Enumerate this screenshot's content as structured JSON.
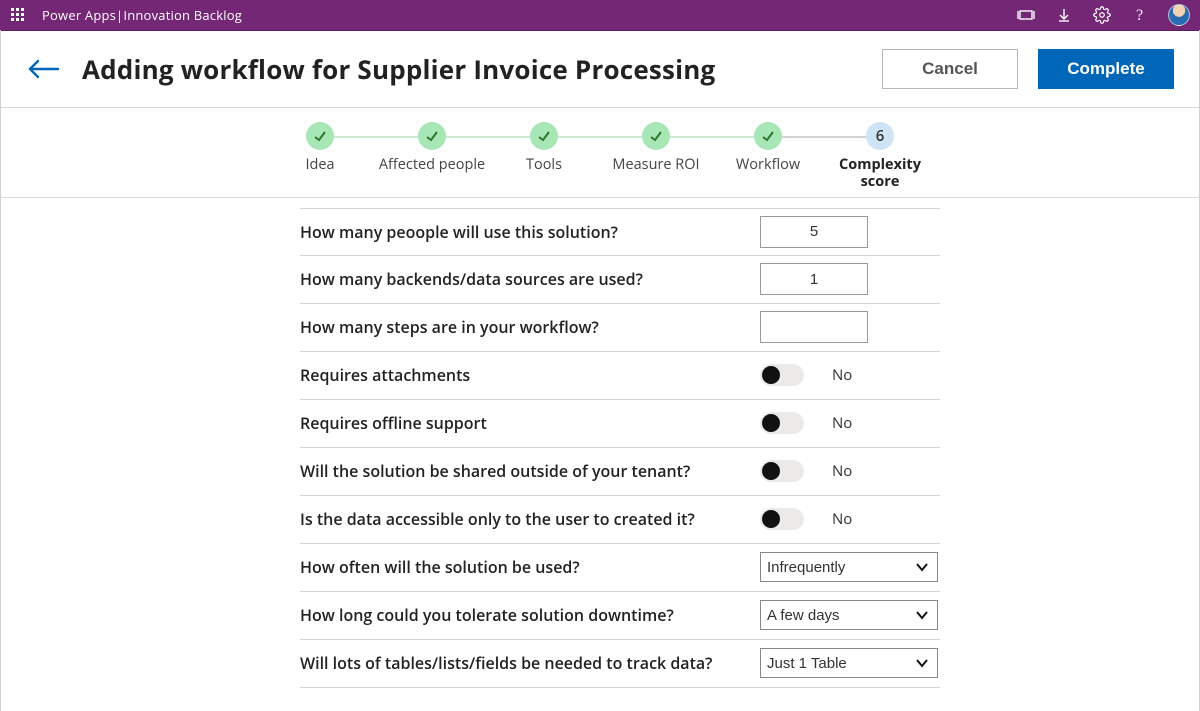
{
  "topbar": {
    "product": "Power Apps",
    "separator": "  |  ",
    "appname": "Innovation Backlog"
  },
  "header": {
    "title": "Adding workflow for Supplier Invoice Processing",
    "cancel": "Cancel",
    "complete": "Complete"
  },
  "stepper": {
    "steps": [
      {
        "label": "Idea",
        "done": true
      },
      {
        "label": "Affected people",
        "done": true
      },
      {
        "label": "Tools",
        "done": true
      },
      {
        "label": "Measure ROI",
        "done": true
      },
      {
        "label": "Workflow",
        "done": true
      },
      {
        "label": "Complexity score",
        "done": false,
        "current": true,
        "num": "6"
      }
    ]
  },
  "form": {
    "q_people": "How many peoople will use this solution?",
    "v_people": "5",
    "q_backends": "How many backends/data sources are  used?",
    "v_backends": "1",
    "q_steps": "How many steps are in your workflow?",
    "v_steps": "",
    "q_attach": "Requires attachments",
    "v_attach": "No",
    "q_offline": "Requires offline support",
    "v_offline": "No",
    "q_shared": "Will the solution be shared  outside of your tenant?",
    "v_shared": "No",
    "q_private": "Is the data accessible only to the user to created it?",
    "v_private": "No",
    "q_freq": "How often will the solution be used?",
    "v_freq": "Infrequently",
    "q_downtime": "How long could you tolerate solution downtime?",
    "v_downtime": "A few days",
    "q_tables": "Will lots of tables/lists/fields be needed to track data?",
    "v_tables": "Just 1 Table"
  }
}
